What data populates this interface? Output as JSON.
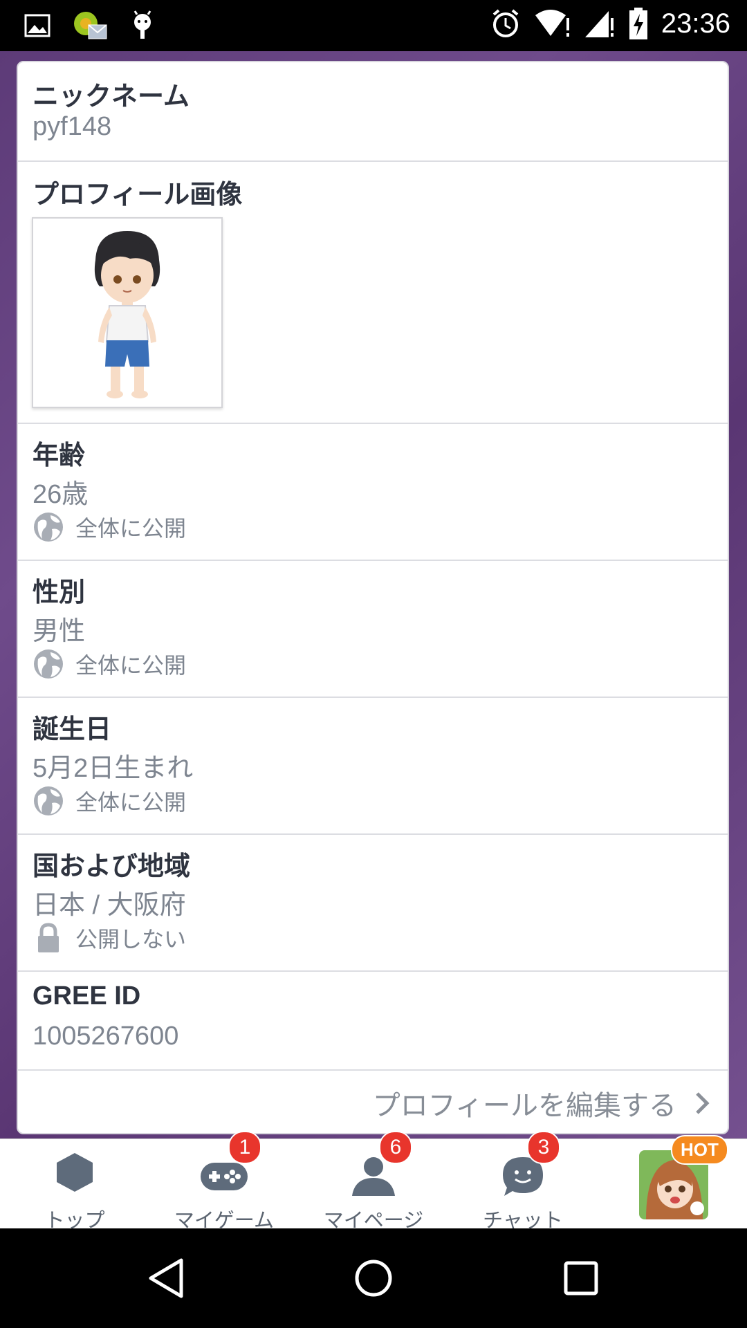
{
  "status_bar": {
    "time": "23:36"
  },
  "profile": {
    "nickname": {
      "label": "ニックネーム",
      "value": "pyf148"
    },
    "image": {
      "label": "プロフィール画像"
    },
    "age": {
      "label": "年齢",
      "value": "26歳",
      "privacy": "全体に公開"
    },
    "gender": {
      "label": "性別",
      "value": "男性",
      "privacy": "全体に公開"
    },
    "birthday": {
      "label": "誕生日",
      "value": "5月2日生まれ",
      "privacy": "全体に公開"
    },
    "region": {
      "label": "国および地域",
      "value": "日本 / 大阪府",
      "privacy": "公開しない"
    },
    "gree_id": {
      "label": "GREE ID",
      "value": "1005267600"
    },
    "edit_link": "プロフィールを編集する"
  },
  "tabs": [
    {
      "label": "トップ",
      "icon": "hexagon-icon"
    },
    {
      "label": "マイゲーム",
      "icon": "gamepad-icon",
      "badge": "1"
    },
    {
      "label": "マイページ",
      "icon": "person-icon",
      "badge": "6"
    },
    {
      "label": "チャット",
      "icon": "chat-icon",
      "badge": "3"
    },
    {
      "label": "",
      "icon": "featured-game-thumbnail",
      "tag": "HOT"
    }
  ],
  "colors": {
    "accent_badge": "#e8352c",
    "hot_tag": "#f58a1f",
    "icon_gray": "#5e6b7b"
  }
}
